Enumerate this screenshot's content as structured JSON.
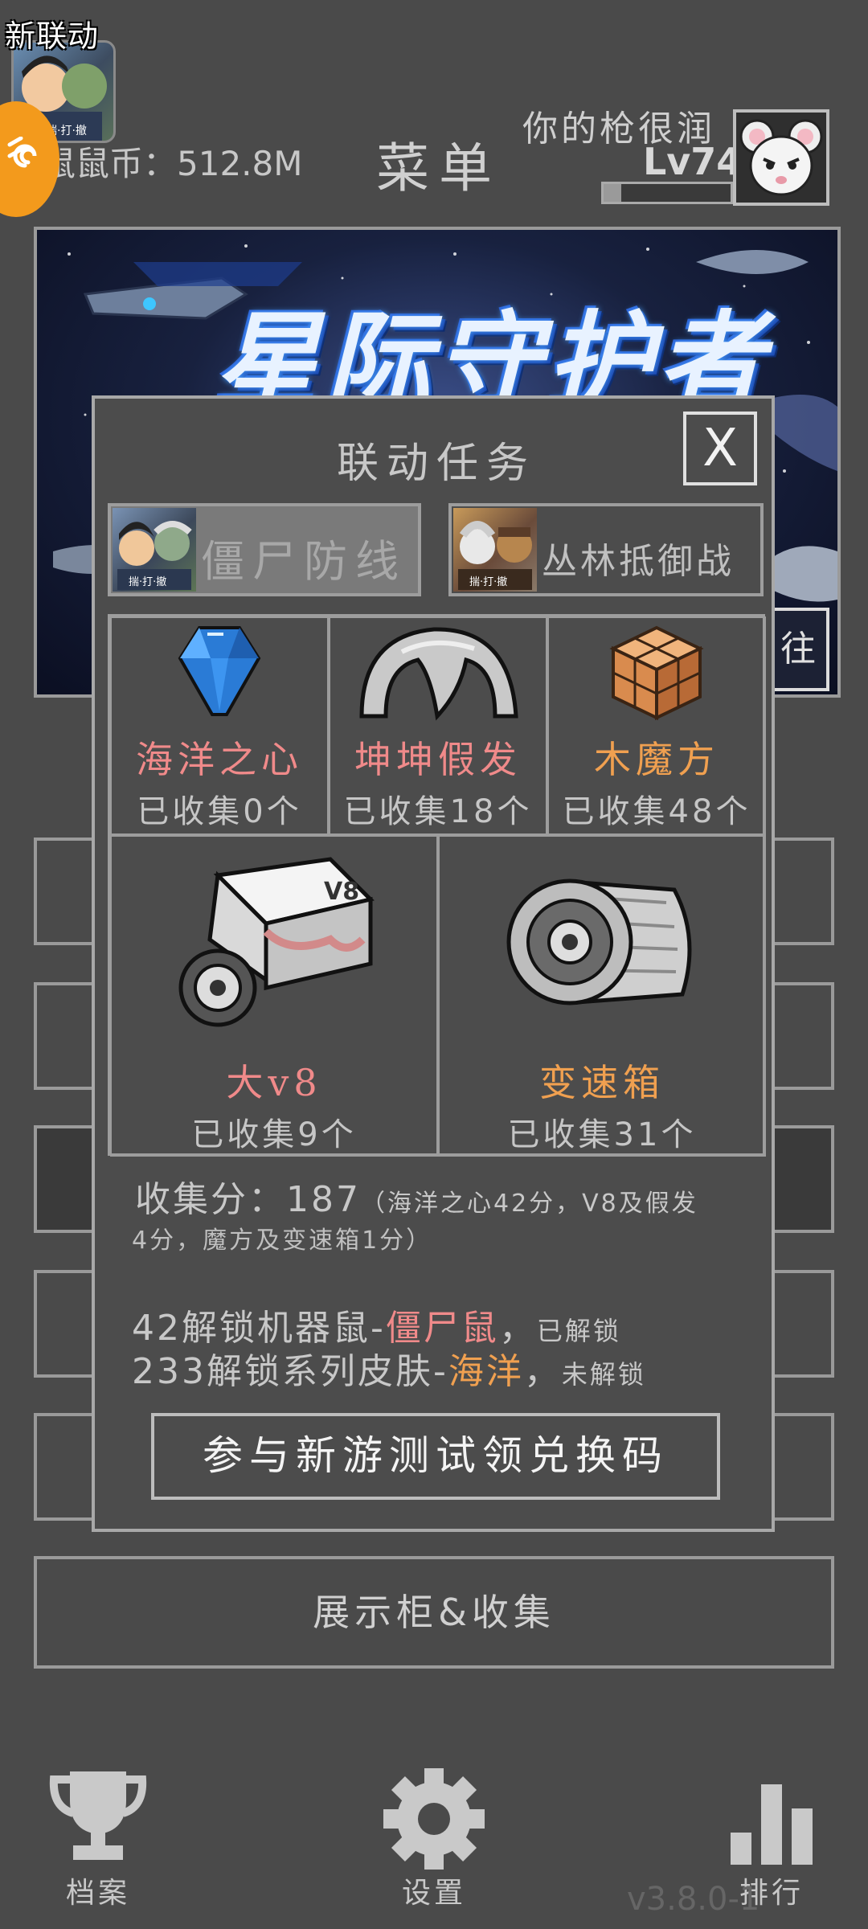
{
  "header": {
    "collab_badge": "新联动",
    "collab_badge_caption": "揣·打·撤",
    "coins": "鼠鼠币：512.8M",
    "menu_title": "菜单",
    "player_name": "你的枪很润",
    "player_level": "Lv74",
    "xp_progress": 0.14
  },
  "banner": {
    "title": "星际守护者",
    "go_label": "往"
  },
  "modal": {
    "title": "联动任务",
    "close_label": "X",
    "tabs": [
      {
        "label": "僵尸防线",
        "caption": "揣·打·撤",
        "active": true
      },
      {
        "label": "丛林抵御战",
        "caption": "揣·打·撤",
        "active": false
      }
    ],
    "items_row1": [
      {
        "name": "海洋之心",
        "count": "已收集0个",
        "color": "#f08a8a",
        "icon": "blue-gem-icon"
      },
      {
        "name": "坤坤假发",
        "count": "已收集18个",
        "color": "#f08a8a",
        "icon": "wig-icon"
      },
      {
        "name": "木魔方",
        "count": "已收集48个",
        "color": "#f0a050",
        "icon": "wooden-cube-icon"
      }
    ],
    "items_row2": [
      {
        "name": "大v8",
        "count": "已收集9个",
        "color": "#f08a8a",
        "icon": "v8-engine-icon",
        "engine_text": "V8"
      },
      {
        "name": "变速箱",
        "count": "已收集31个",
        "color": "#f0a050",
        "icon": "gearbox-icon"
      }
    ],
    "score_label": "收集分：",
    "score_value": "187",
    "score_note_line1": "（海洋之心42分，V8及假发",
    "score_note_line2": "4分，魔方及变速箱1分）",
    "unlock1": {
      "prefix": "42解锁机器鼠-",
      "target": "僵尸鼠",
      "suffix": "，",
      "status": "已解锁"
    },
    "unlock2": {
      "prefix": "233解锁系列皮肤-",
      "target": "海洋",
      "suffix": "，",
      "status": "未解锁"
    },
    "redeem_button": "参与新游测试领兑换码"
  },
  "showcase_button": "展示柜&收集",
  "nav": {
    "archive": "档案",
    "settings": "设置",
    "ranking": "排行"
  },
  "version": "v3.8.0-1",
  "colors": {
    "background": "#4a4a4a",
    "accent_orange": "#f39a1c",
    "highlight_pink": "#f08a8a",
    "highlight_orange": "#f0a050"
  }
}
